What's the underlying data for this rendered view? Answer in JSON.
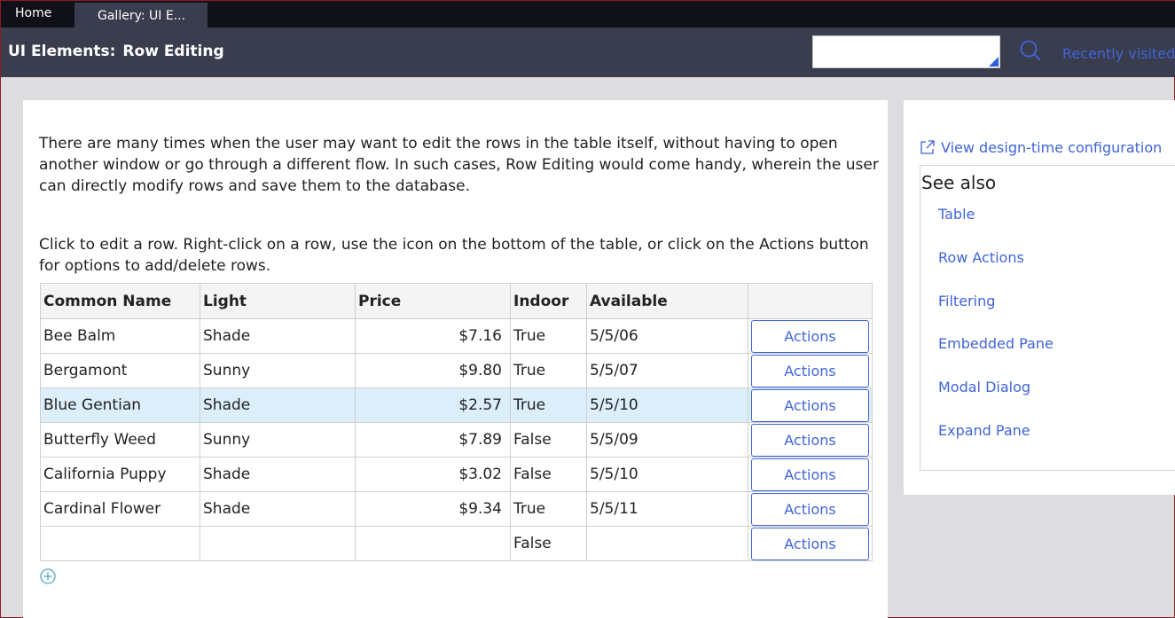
{
  "tabs": {
    "home": "Home",
    "gallery": "Gallery: UI E..."
  },
  "header": {
    "title_prefix": "UI Elements:",
    "title_main": "Row Editing",
    "search_value": "",
    "recent": "Recently visited"
  },
  "main": {
    "intro": "There are many times when the user may want to edit the rows in the table itself, without having to open another window or go through a different flow. In such cases, Row Editing would come handy, wherein the user can directly modify rows and save them to the database.",
    "instructions": "Click to edit a row. Right-click on a row, use the icon on the bottom of the table, or click on the Actions button for options to add/delete rows.",
    "columns": [
      "Common Name",
      "Light",
      "Price",
      "Indoor",
      "Available",
      ""
    ],
    "rows": [
      {
        "name": "Bee Balm",
        "light": "Shade",
        "price": "$7.16",
        "indoor": "True",
        "available": "5/5/06",
        "action": "Actions"
      },
      {
        "name": "Bergamont",
        "light": "Sunny",
        "price": "$9.80",
        "indoor": "True",
        "available": "5/5/07",
        "action": "Actions"
      },
      {
        "name": "Blue Gentian",
        "light": "Shade",
        "price": "$2.57",
        "indoor": "True",
        "available": "5/5/10",
        "action": "Actions"
      },
      {
        "name": "Butterfly Weed",
        "light": "Sunny",
        "price": "$7.89",
        "indoor": "False",
        "available": "5/5/09",
        "action": "Actions"
      },
      {
        "name": "California Puppy",
        "light": "Shade",
        "price": "$3.02",
        "indoor": "False",
        "available": "5/5/10",
        "action": "Actions"
      },
      {
        "name": "Cardinal Flower",
        "light": "Shade",
        "price": "$9.34",
        "indoor": "True",
        "available": "5/5/11",
        "action": "Actions"
      },
      {
        "name": "",
        "light": "",
        "price": "",
        "indoor": "False",
        "available": "",
        "action": "Actions"
      }
    ],
    "selected_row": 2
  },
  "side": {
    "design_link": "View design-time configuration",
    "see_also_title": "See also",
    "see_also": [
      "Table",
      "Row Actions",
      "Filtering",
      "Embedded Pane",
      "Modal Dialog",
      "Expand Pane"
    ]
  },
  "icons": {
    "search": "search-icon",
    "external_link": "external-link-icon",
    "add_row": "add-row-icon"
  },
  "colors": {
    "tabbar": "#101018",
    "header": "#3a3d4e",
    "link": "#3f64d8",
    "selected_row": "#dbeefa"
  }
}
